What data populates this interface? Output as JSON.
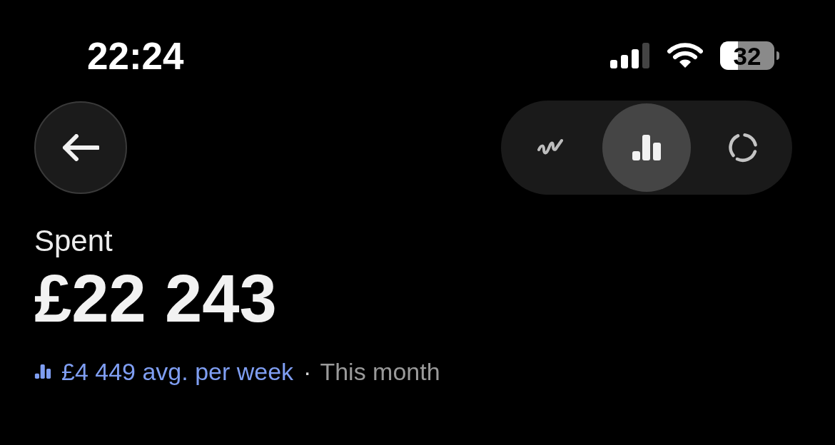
{
  "status_bar": {
    "time": "22:24",
    "battery": "32"
  },
  "view_switcher": {
    "options": [
      {
        "kind": "line",
        "selected": false
      },
      {
        "kind": "bar",
        "selected": true
      },
      {
        "kind": "ring",
        "selected": false
      }
    ]
  },
  "summary": {
    "label": "Spent",
    "amount": "£22 243",
    "average": "£4 449 avg. per week",
    "separator": "·",
    "period": "This month"
  }
}
